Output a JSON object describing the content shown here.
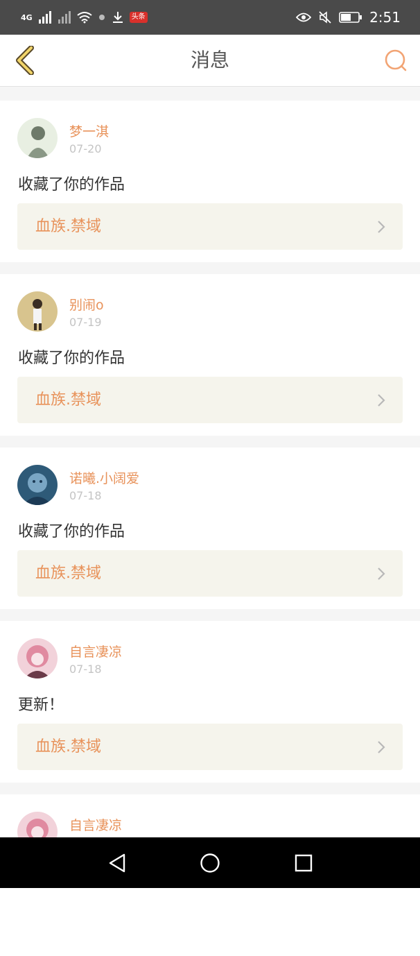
{
  "status_bar": {
    "network_label": "4G",
    "toutiao_label": "头条",
    "time": "2:51"
  },
  "header": {
    "title": "消息",
    "accent_color": "#e8925a"
  },
  "messages": [
    {
      "username": "梦一淇",
      "date": "07-20",
      "text": "收藏了你的作品",
      "work": "血族.禁域",
      "avatar_colors": [
        "#e8efe2",
        "#7a8a78"
      ]
    },
    {
      "username": "别闹o",
      "date": "07-19",
      "text": "收藏了你的作品",
      "work": "血族.禁域",
      "avatar_colors": [
        "#d8c48e",
        "#5a4a3a"
      ]
    },
    {
      "username": "诺曦.小阔爱",
      "date": "07-18",
      "text": "收藏了你的作品",
      "work": "血族.禁域",
      "avatar_colors": [
        "#4a7a9a",
        "#1c3a55"
      ]
    },
    {
      "username": "自言凄凉",
      "date": "07-18",
      "text": "更新！",
      "work": "血族.禁域",
      "avatar_colors": [
        "#e8a6b4",
        "#8a4a5a"
      ]
    },
    {
      "username": "自言凄凉",
      "date": "",
      "text": "",
      "work": "",
      "avatar_colors": [
        "#e8a6b4",
        "#8a4a5a"
      ]
    }
  ]
}
